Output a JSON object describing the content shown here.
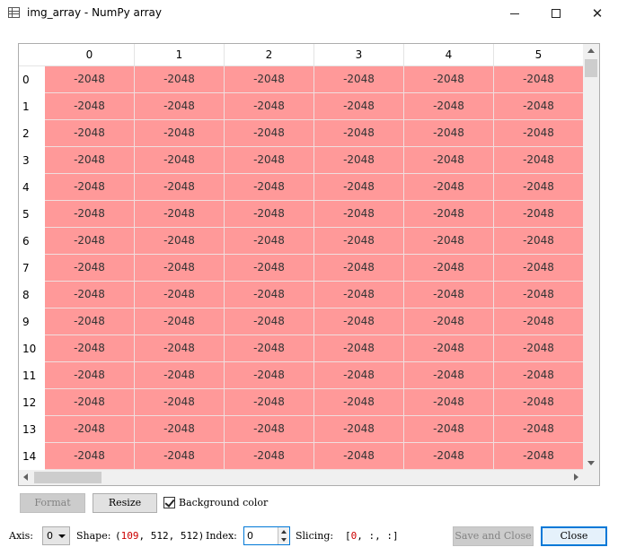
{
  "window": {
    "title": "img_array - NumPy array",
    "minimize_label": "",
    "close_glyph": "✕"
  },
  "table": {
    "columns": [
      "0",
      "1",
      "2",
      "3",
      "4",
      "5"
    ],
    "rows": [
      "0",
      "1",
      "2",
      "3",
      "4",
      "5",
      "6",
      "7",
      "8",
      "9",
      "10",
      "11",
      "12",
      "13",
      "14"
    ],
    "cell_value": "-2048",
    "cell_color": "#ff9999"
  },
  "toolbar": {
    "format_label": "Format",
    "resize_label": "Resize",
    "background_color_label": "Background color",
    "background_color_checked": true
  },
  "footer": {
    "axis_label": "Axis:",
    "axis_value": "0",
    "shape_label": "Shape:",
    "shape_open": "(",
    "shape_first": "109",
    "shape_rest": ", 512, 512)",
    "index_label": "Index:",
    "index_value": "0",
    "slicing_label": "Slicing:",
    "slicing_open": "[",
    "slicing_first": "0",
    "slicing_rest": ", :, :]",
    "save_close_label": "Save and Close",
    "close_label": "Close"
  }
}
